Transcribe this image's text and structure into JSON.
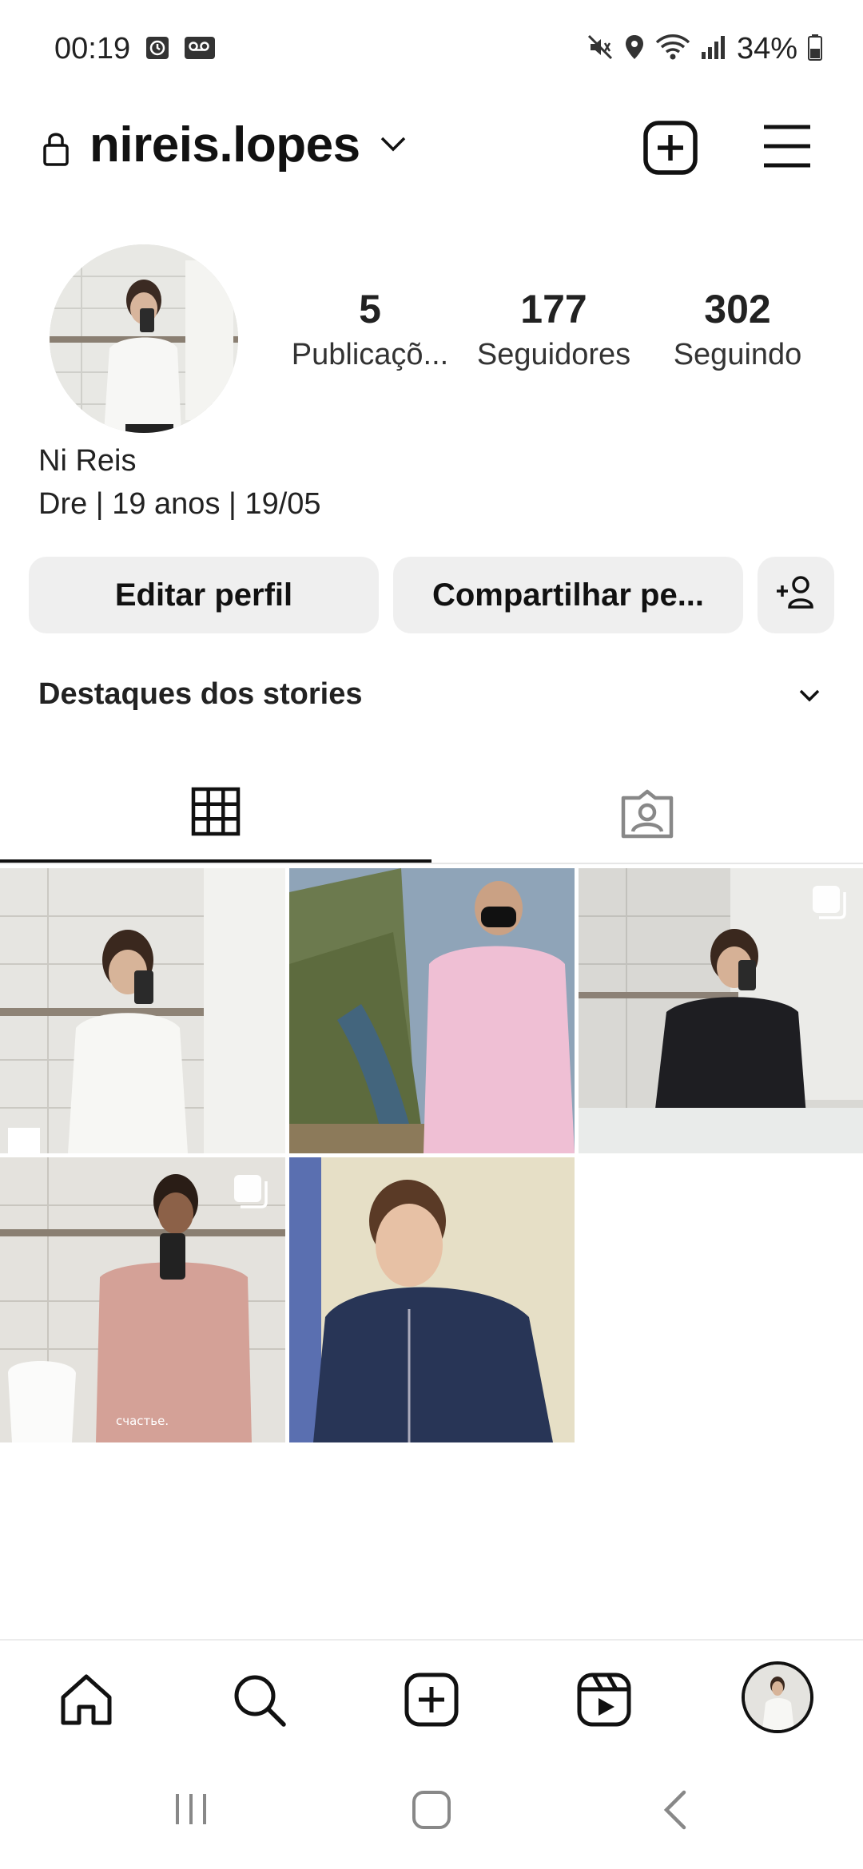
{
  "status_bar": {
    "time": "00:19",
    "battery": "34%",
    "icons": [
      "alarm-icon",
      "voicemail-icon",
      "mute-icon",
      "location-icon",
      "wifi-icon",
      "signal-icon",
      "battery-icon"
    ]
  },
  "header": {
    "username": "nireis.lopes",
    "icons": [
      "lock-icon",
      "chevron-down-icon",
      "new-post-icon",
      "menu-icon"
    ]
  },
  "profile": {
    "stats": [
      {
        "value": "5",
        "label": "Publicaçõ..."
      },
      {
        "value": "177",
        "label": "Seguidores"
      },
      {
        "value": "302",
        "label": "Seguindo"
      }
    ],
    "name": "Ni Reis",
    "bio": "Dre | 19 anos | 19/05"
  },
  "actions": {
    "edit_label": "Editar perfil",
    "share_label": "Compartilhar pe..."
  },
  "highlights": {
    "label": "Destaques dos stories"
  },
  "tabs": [
    "grid-icon",
    "tagged-icon"
  ],
  "posts": [
    {
      "multi": false
    },
    {
      "multi": false
    },
    {
      "multi": true
    },
    {
      "multi": true,
      "caption": "счастье."
    },
    {
      "multi": false
    }
  ],
  "bottom_nav": [
    "home-icon",
    "search-icon",
    "create-icon",
    "reels-icon",
    "profile-avatar"
  ],
  "colors": {
    "text": "#111111",
    "button_bg": "#efefef",
    "divider": "#e6e6e6"
  }
}
